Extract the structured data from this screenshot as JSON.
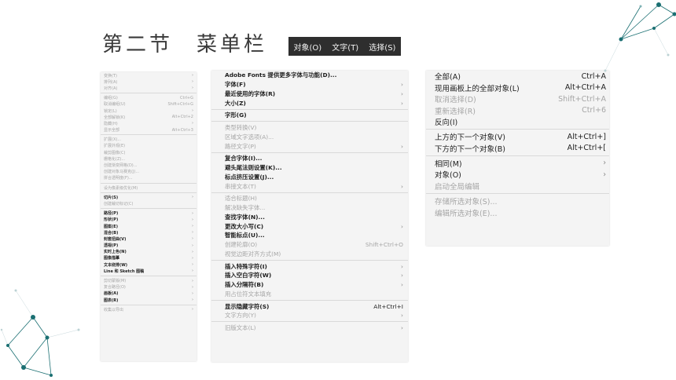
{
  "slide": {
    "title": "第二节　菜单栏"
  },
  "menubar": [
    "对象(O)",
    "文字(T)",
    "选择(S)"
  ],
  "object_menu": {
    "items": [
      {
        "label": "变换(T)",
        "sub": true,
        "state": "dim"
      },
      {
        "label": "排列(A)",
        "sub": true,
        "state": "dim"
      },
      {
        "label": "对齐(A)",
        "sub": true,
        "state": "dim"
      },
      {
        "sep": true
      },
      {
        "label": "编组(G)",
        "shortcut": "Ctrl+G",
        "state": "dim"
      },
      {
        "label": "取消编组(U)",
        "shortcut": "Shift+Ctrl+G",
        "state": "dim"
      },
      {
        "label": "锁定(L)",
        "sub": true,
        "state": "dim"
      },
      {
        "label": "全部解锁(K)",
        "shortcut": "Alt+Ctrl+2",
        "state": "dim"
      },
      {
        "label": "隐藏(H)",
        "sub": true,
        "state": "dim"
      },
      {
        "label": "显示全部",
        "shortcut": "Alt+Ctrl+3",
        "state": "dim"
      },
      {
        "sep": true
      },
      {
        "label": "扩展(X)...",
        "state": "dim"
      },
      {
        "label": "扩展外观(E)",
        "state": "dim"
      },
      {
        "label": "裁剪图像(C)",
        "state": "dim"
      },
      {
        "label": "栅格化(Z)...",
        "state": "dim"
      },
      {
        "label": "创建渐变网格(D)...",
        "state": "dim"
      },
      {
        "label": "创建对象马赛克(J)...",
        "state": "dim"
      },
      {
        "label": "拼合透明度(F)...",
        "state": "dim"
      },
      {
        "sep": true
      },
      {
        "label": "设为像素级优化(M)",
        "state": "dim"
      },
      {
        "sep": true
      },
      {
        "label": "切片(S)",
        "sub": true,
        "state": "normal"
      },
      {
        "label": "创建裁切标记(C)",
        "state": "dim"
      },
      {
        "sep": true
      },
      {
        "label": "路径(P)",
        "sub": true,
        "state": "normal"
      },
      {
        "label": "形状(P)",
        "sub": true,
        "state": "normal"
      },
      {
        "label": "图案(E)",
        "sub": true,
        "state": "normal"
      },
      {
        "label": "混合(B)",
        "sub": true,
        "state": "normal"
      },
      {
        "label": "封套扭曲(V)",
        "sub": true,
        "state": "normal"
      },
      {
        "label": "透视(P)",
        "sub": true,
        "state": "normal"
      },
      {
        "label": "实时上色(N)",
        "sub": true,
        "state": "normal"
      },
      {
        "label": "图像描摹",
        "sub": true,
        "state": "normal"
      },
      {
        "label": "文本绕排(W)",
        "sub": true,
        "state": "normal"
      },
      {
        "label": "Line 和 Sketch 图稿",
        "sub": true,
        "state": "normal"
      },
      {
        "sep": true
      },
      {
        "label": "剪切蒙版(M)",
        "sub": true,
        "state": "dim"
      },
      {
        "label": "复合路径(O)",
        "sub": true,
        "state": "dim"
      },
      {
        "label": "画板(A)",
        "sub": true,
        "state": "normal"
      },
      {
        "label": "图表(R)",
        "sub": true,
        "state": "normal"
      },
      {
        "sep": true
      },
      {
        "label": "收集以导出",
        "sub": true,
        "state": "dim"
      }
    ]
  },
  "type_menu": {
    "items": [
      {
        "label": "Adobe Fonts 提供更多字体与功能(D)...",
        "state": "normal"
      },
      {
        "label": "字体(F)",
        "sub": true,
        "state": "normal"
      },
      {
        "label": "最近使用的字体(R)",
        "sub": true,
        "state": "normal"
      },
      {
        "label": "大小(Z)",
        "sub": true,
        "state": "normal"
      },
      {
        "sep": true
      },
      {
        "label": "字形(G)",
        "state": "normal"
      },
      {
        "sep": true
      },
      {
        "label": "类型转换(V)",
        "state": "dim"
      },
      {
        "label": "区域文字选项(A)...",
        "state": "dim"
      },
      {
        "label": "路径文字(P)",
        "sub": true,
        "state": "dim"
      },
      {
        "sep": true
      },
      {
        "label": "复合字体(I)...",
        "state": "normal"
      },
      {
        "label": "避头尾法则设置(K)...",
        "state": "normal"
      },
      {
        "label": "标点挤压设置(J)...",
        "state": "normal"
      },
      {
        "label": "串接文本(T)",
        "sub": true,
        "state": "dim"
      },
      {
        "sep": true
      },
      {
        "label": "适合标题(H)",
        "state": "dim"
      },
      {
        "label": "解决缺失字体...",
        "state": "dim"
      },
      {
        "label": "查找字体(N)...",
        "state": "normal"
      },
      {
        "label": "更改大小写(C)",
        "sub": true,
        "state": "normal"
      },
      {
        "label": "智能标点(U)...",
        "state": "normal"
      },
      {
        "label": "创建轮廓(O)",
        "shortcut": "Shift+Ctrl+O",
        "state": "dim"
      },
      {
        "label": "视觉边距对齐方式(M)",
        "state": "dim"
      },
      {
        "sep": true
      },
      {
        "label": "插入特殊字符(I)",
        "sub": true,
        "state": "normal"
      },
      {
        "label": "插入空白字符(W)",
        "sub": true,
        "state": "normal"
      },
      {
        "label": "插入分隔符(B)",
        "sub": true,
        "state": "normal"
      },
      {
        "label": "用占位符文本填充",
        "state": "dim"
      },
      {
        "sep": true
      },
      {
        "label": "显示隐藏字符(S)",
        "shortcut": "Alt+Ctrl+I",
        "state": "normal"
      },
      {
        "label": "文字方向(Y)",
        "sub": true,
        "state": "dim"
      },
      {
        "sep": true
      },
      {
        "label": "旧版文本(L)",
        "sub": true,
        "state": "dim"
      }
    ]
  },
  "select_menu": {
    "items": [
      {
        "label": "全部(A)",
        "shortcut": "Ctrl+A",
        "state": "normal"
      },
      {
        "label": "现用画板上的全部对象(L)",
        "shortcut": "Alt+Ctrl+A",
        "state": "normal"
      },
      {
        "label": "取消选择(D)",
        "shortcut": "Shift+Ctrl+A",
        "state": "dim"
      },
      {
        "label": "重新选择(R)",
        "shortcut": "Ctrl+6",
        "state": "dim"
      },
      {
        "label": "反向(I)",
        "state": "normal"
      },
      {
        "sep": true
      },
      {
        "label": "上方的下一个对象(V)",
        "shortcut": "Alt+Ctrl+]",
        "state": "normal"
      },
      {
        "label": "下方的下一个对象(B)",
        "shortcut": "Alt+Ctrl+[",
        "state": "normal"
      },
      {
        "sep": true
      },
      {
        "label": "相同(M)",
        "sub": true,
        "state": "normal"
      },
      {
        "label": "对象(O)",
        "sub": true,
        "state": "normal"
      },
      {
        "label": "启动全局编辑",
        "state": "dim"
      },
      {
        "sep": true
      },
      {
        "label": "存储所选对象(S)...",
        "state": "dim"
      },
      {
        "label": "编辑所选对象(E)...",
        "state": "dim"
      }
    ]
  },
  "colors": {
    "menubar_bg": "#2e2e2e",
    "menu_bg": "#f4f4f4",
    "dim_text": "#a6a6a6",
    "normal_text": "#1e1e1e",
    "decoration_teal": "#1a6f72"
  },
  "icons": [
    "submenu-chevron-icon",
    "network-decoration"
  ]
}
